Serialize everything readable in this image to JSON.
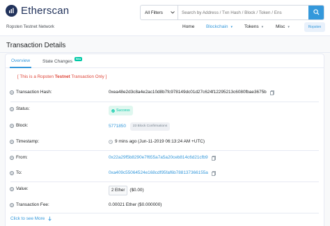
{
  "header": {
    "logo_text": "Etherscan",
    "network": "Ropsten Testnet Network",
    "search": {
      "filter_label": "All Filters",
      "placeholder": "Search by Address / Txn Hash / Block / Token / Ens"
    },
    "nav": [
      {
        "label": "Home",
        "dropdown": false
      },
      {
        "label": "Blockchain",
        "dropdown": true,
        "active": true
      },
      {
        "label": "Tokens",
        "dropdown": true
      },
      {
        "label": "Misc",
        "dropdown": true
      }
    ],
    "eth_button": "Ropsten"
  },
  "page": {
    "title": "Transaction Details"
  },
  "tabs": [
    {
      "label": "Overview",
      "active": true
    },
    {
      "label": "State Changes",
      "badge": "New"
    }
  ],
  "notice": {
    "prefix": "[ This is a Ropsten ",
    "bold": "Testnet",
    "suffix": " Transaction Only ]"
  },
  "details": {
    "tx_hash": {
      "label": "Transaction Hash:",
      "value": "0xea48e2d3c8a4e2ac10d8b7fc978149dc01d27c624f12295213c6080fbae3675b"
    },
    "status": {
      "label": "Status:",
      "value": "Success"
    },
    "block": {
      "label": "Block:",
      "value": "5771850",
      "confirmations": "23 Block Confirmations"
    },
    "timestamp": {
      "label": "Timestamp:",
      "value": "9 mins ago (Jun-11-2019 06:13:24 AM +UTC)"
    },
    "from": {
      "label": "From:",
      "value": "0x22a29f5b8290e7f655a7a5a20ceb814c6d21cfb9"
    },
    "to": {
      "label": "To:",
      "value": "0xa409c55064524e168cdf95faf6b788137366155a"
    },
    "value": {
      "label": "Value:",
      "amount": "2 Ether",
      "usd": "($0.00)"
    },
    "fee": {
      "label": "Transaction Fee:",
      "value": "0.00021 Ether ($0.000000)"
    }
  },
  "see_more": "Click to see More",
  "colors": {
    "primary": "#3498db",
    "navy": "#21325b",
    "success": "#00c9a7",
    "danger": "#de4437"
  }
}
